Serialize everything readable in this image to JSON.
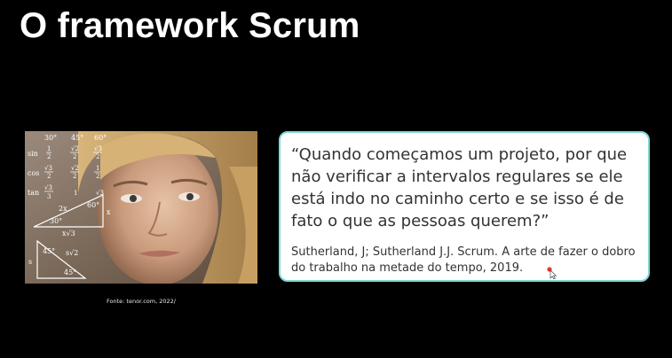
{
  "slide": {
    "title": "O framework Scrum"
  },
  "image": {
    "math_labels": {
      "deg30": "30°",
      "deg45": "45°",
      "deg60": "60°",
      "sin": "sin",
      "cos": "cos",
      "tan": "tan",
      "triangle_30": "30°",
      "triangle_60": "60°",
      "triangle_45": "45°",
      "triangle_45b": "45°",
      "x": "x",
      "two_x": "2x",
      "x_sqrt3": "x√3",
      "s": "s",
      "s_sqrt2": "s√2"
    },
    "caption": "Fonte: tenor.com, 2022/"
  },
  "quote": {
    "text": "“Quando começamos um projeto, por que não verificar a intervalos regulares se ele está indo no caminho certo e se isso é de fato o que as pessoas querem?”",
    "source": "Sutherland, J; Sutherland J.J. Scrum. A arte de fazer o dobro do trabalho na metade do tempo, 2019."
  },
  "colors": {
    "background": "#000000",
    "card_border": "#7fd7d3",
    "cursor_dot": "#e53935"
  },
  "icons": {
    "cursor": "mouse-pointer-icon"
  }
}
